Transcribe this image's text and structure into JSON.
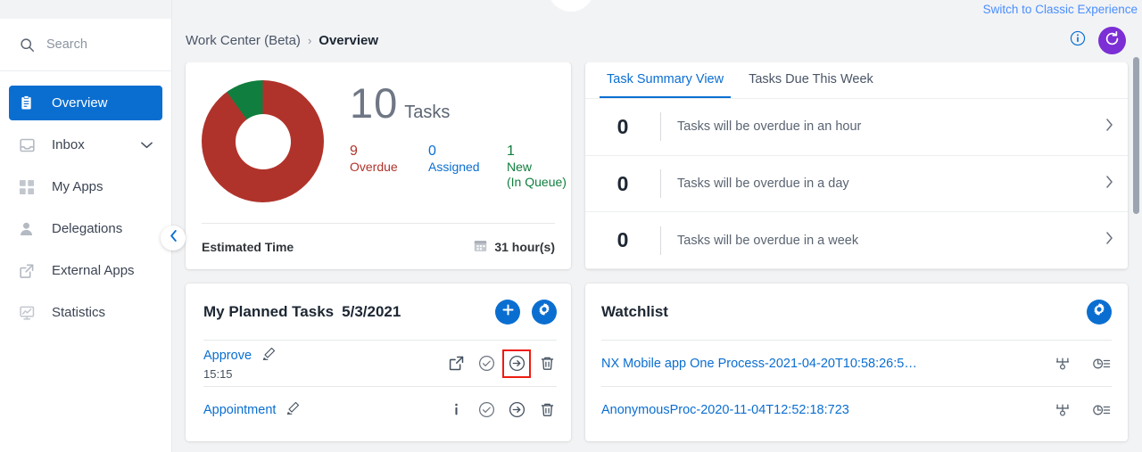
{
  "topbar": {
    "classic_link": "Switch to Classic Experience",
    "info_icon": "info-circle-icon",
    "refresh_icon": "refresh-icon",
    "refresh_color": "#7b2fd4"
  },
  "breadcrumb": {
    "root": "Work Center (Beta)",
    "separator": "›",
    "current": "Overview"
  },
  "sidebar": {
    "search": {
      "placeholder": "Search",
      "icon": "search-icon"
    },
    "collapse_icon": "chevron-left-icon",
    "items": [
      {
        "label": "Overview",
        "icon": "clipboard-icon",
        "active": true
      },
      {
        "label": "Inbox",
        "icon": "inbox-icon",
        "active": false,
        "chevron": "chevron-down-icon"
      },
      {
        "label": "My Apps",
        "icon": "grid-icon",
        "active": false
      },
      {
        "label": "Delegations",
        "icon": "person-icon",
        "active": false
      },
      {
        "label": "External Apps",
        "icon": "external-link-icon",
        "active": false
      },
      {
        "label": "Statistics",
        "icon": "chart-icon",
        "active": false
      }
    ]
  },
  "summary": {
    "total": "10",
    "total_unit": "Tasks",
    "legend": [
      {
        "value": "9",
        "label": "Overdue",
        "color": "#b0332b"
      },
      {
        "value": "0",
        "label": "Assigned",
        "color": "#0a6ed1"
      },
      {
        "value": "1",
        "label": "New\n(In Queue)",
        "label_line1": "New",
        "label_line2": "(In Queue)",
        "color": "#107e3e"
      }
    ],
    "estimated_label": "Estimated Time",
    "estimated_value": "31 hour(s)",
    "estimated_icon": "calendar-icon"
  },
  "chart_data": {
    "type": "pie",
    "title": "Task Status Distribution",
    "categories": [
      "Overdue",
      "Assigned",
      "New (In Queue)"
    ],
    "values": [
      9,
      0,
      1
    ],
    "colors": [
      "#b0332b",
      "#0a6ed1",
      "#107e3e"
    ],
    "total": 10,
    "donut": true,
    "inner_radius_ratio": 0.45,
    "legend_position": "right",
    "start_angle_deg": 0,
    "direction": "clockwise"
  },
  "task_summary": {
    "tabs": [
      {
        "label": "Task Summary View",
        "active": true
      },
      {
        "label": "Tasks Due This Week",
        "active": false
      }
    ],
    "rows": [
      {
        "count": "0",
        "text": "Tasks will be overdue in an hour",
        "chevron": "chevron-right-icon"
      },
      {
        "count": "0",
        "text": "Tasks will be overdue in a day",
        "chevron": "chevron-right-icon"
      },
      {
        "count": "0",
        "text": "Tasks will be overdue in a week",
        "chevron": "chevron-right-icon"
      }
    ]
  },
  "planned_tasks": {
    "title": "My Planned Tasks",
    "date": "5/3/2021",
    "add_icon": "plus-icon",
    "settings_icon": "gear-icon",
    "rows": [
      {
        "name": "Approve",
        "edit_icon": "pencil-icon",
        "time": "15:15",
        "actions": [
          "external-link-icon",
          "check-circle-icon",
          "arrow-right-circle-icon",
          "trash-icon"
        ],
        "highlighted_action": "arrow-right-circle-icon"
      },
      {
        "name": "Appointment",
        "edit_icon": "pencil-icon",
        "time": "",
        "actions": [
          "info-icon",
          "check-circle-icon",
          "arrow-right-circle-icon",
          "trash-icon"
        ],
        "highlighted_action": ""
      }
    ]
  },
  "watchlist": {
    "title": "Watchlist",
    "settings_icon": "gear-icon",
    "rows": [
      {
        "name": "NX Mobile app One Process-2021-04-20T10:58:26:5…",
        "actions": [
          "process-flow-icon",
          "history-icon"
        ]
      },
      {
        "name": "AnonymousProc-2020-11-04T12:52:18:723",
        "actions": [
          "process-flow-icon",
          "history-icon"
        ]
      }
    ]
  }
}
